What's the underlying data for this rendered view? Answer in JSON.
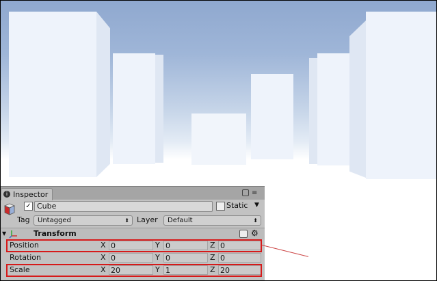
{
  "inspector": {
    "tab_label": "Inspector",
    "object_name": "Cube",
    "static_label": "Static",
    "tag_label": "Tag",
    "tag_value": "Untagged",
    "layer_label": "Layer",
    "layer_value": "Default",
    "active_checked": true,
    "static_checked": false
  },
  "transform": {
    "title": "Transform",
    "rows": [
      {
        "label": "Position",
        "x": "0",
        "y": "0",
        "z": "0",
        "highlighted": true
      },
      {
        "label": "Rotation",
        "x": "0",
        "y": "0",
        "z": "0",
        "highlighted": false
      },
      {
        "label": "Scale",
        "x": "20",
        "y": "1",
        "z": "20",
        "highlighted": true
      }
    ],
    "axis_labels": {
      "x": "X",
      "y": "Y",
      "z": "Z"
    }
  },
  "colors": {
    "highlight": "#d61a1a",
    "sky_top": "#8fa8cf",
    "panel_bg": "#c2c2c2"
  }
}
